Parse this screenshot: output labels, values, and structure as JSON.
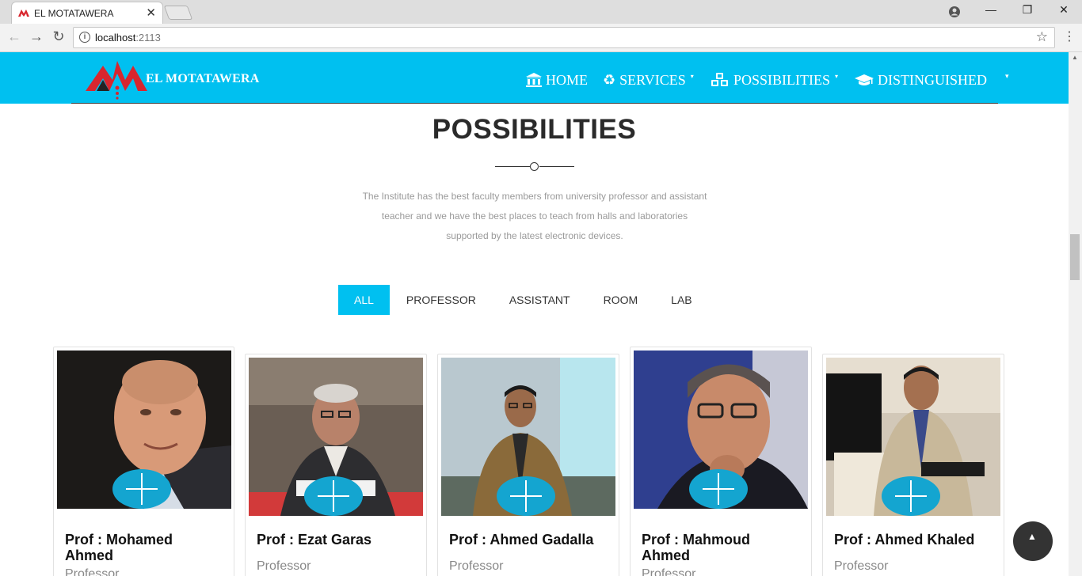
{
  "browser": {
    "tab_title": "EL MOTATAWERA",
    "tab_close": "✕",
    "url_host": "localhost",
    "url_port": ":2113",
    "window_controls": [
      "—",
      "❐",
      "✕"
    ]
  },
  "header": {
    "logo_text": "EL MOTATAWERA",
    "nav": [
      {
        "label": "HOME",
        "icon": "bank-icon",
        "has_caret": false
      },
      {
        "label": "SERVICES",
        "icon": "recycle-icon",
        "has_caret": true
      },
      {
        "label": "POSSIBILITIES",
        "icon": "cubes-icon",
        "has_caret": true
      },
      {
        "label": "DISTINGUISHED",
        "icon": "graduation-cap-icon",
        "has_caret": false
      }
    ],
    "dropdown_caret": "▾"
  },
  "section": {
    "title": "POSSIBILITIES",
    "intro": "The Institute has the best faculty members from university professor and assistant teacher and we have the best places to teach from halls and laboratories supported by the latest electronic devices."
  },
  "filters": [
    {
      "label": "ALL",
      "active": true
    },
    {
      "label": "PROFESSOR",
      "active": false
    },
    {
      "label": "ASSISTANT",
      "active": false
    },
    {
      "label": "ROOM",
      "active": false
    },
    {
      "label": "LAB",
      "active": false
    }
  ],
  "cards": [
    {
      "name": "Prof : Mohamed Ahmed",
      "role": "Professor"
    },
    {
      "name": "Prof : Ezat Garas",
      "role": "Professor"
    },
    {
      "name": "Prof : Ahmed Gadalla",
      "role": "Professor"
    },
    {
      "name": "Prof : Mahmoud Ahmed",
      "role": "Professor"
    },
    {
      "name": "Prof : Ahmed Khaled",
      "role": "Professor"
    }
  ],
  "colors": {
    "brand": "#00c0f0",
    "plus_button": "#14a5d0",
    "logo_red": "#d8262e"
  }
}
